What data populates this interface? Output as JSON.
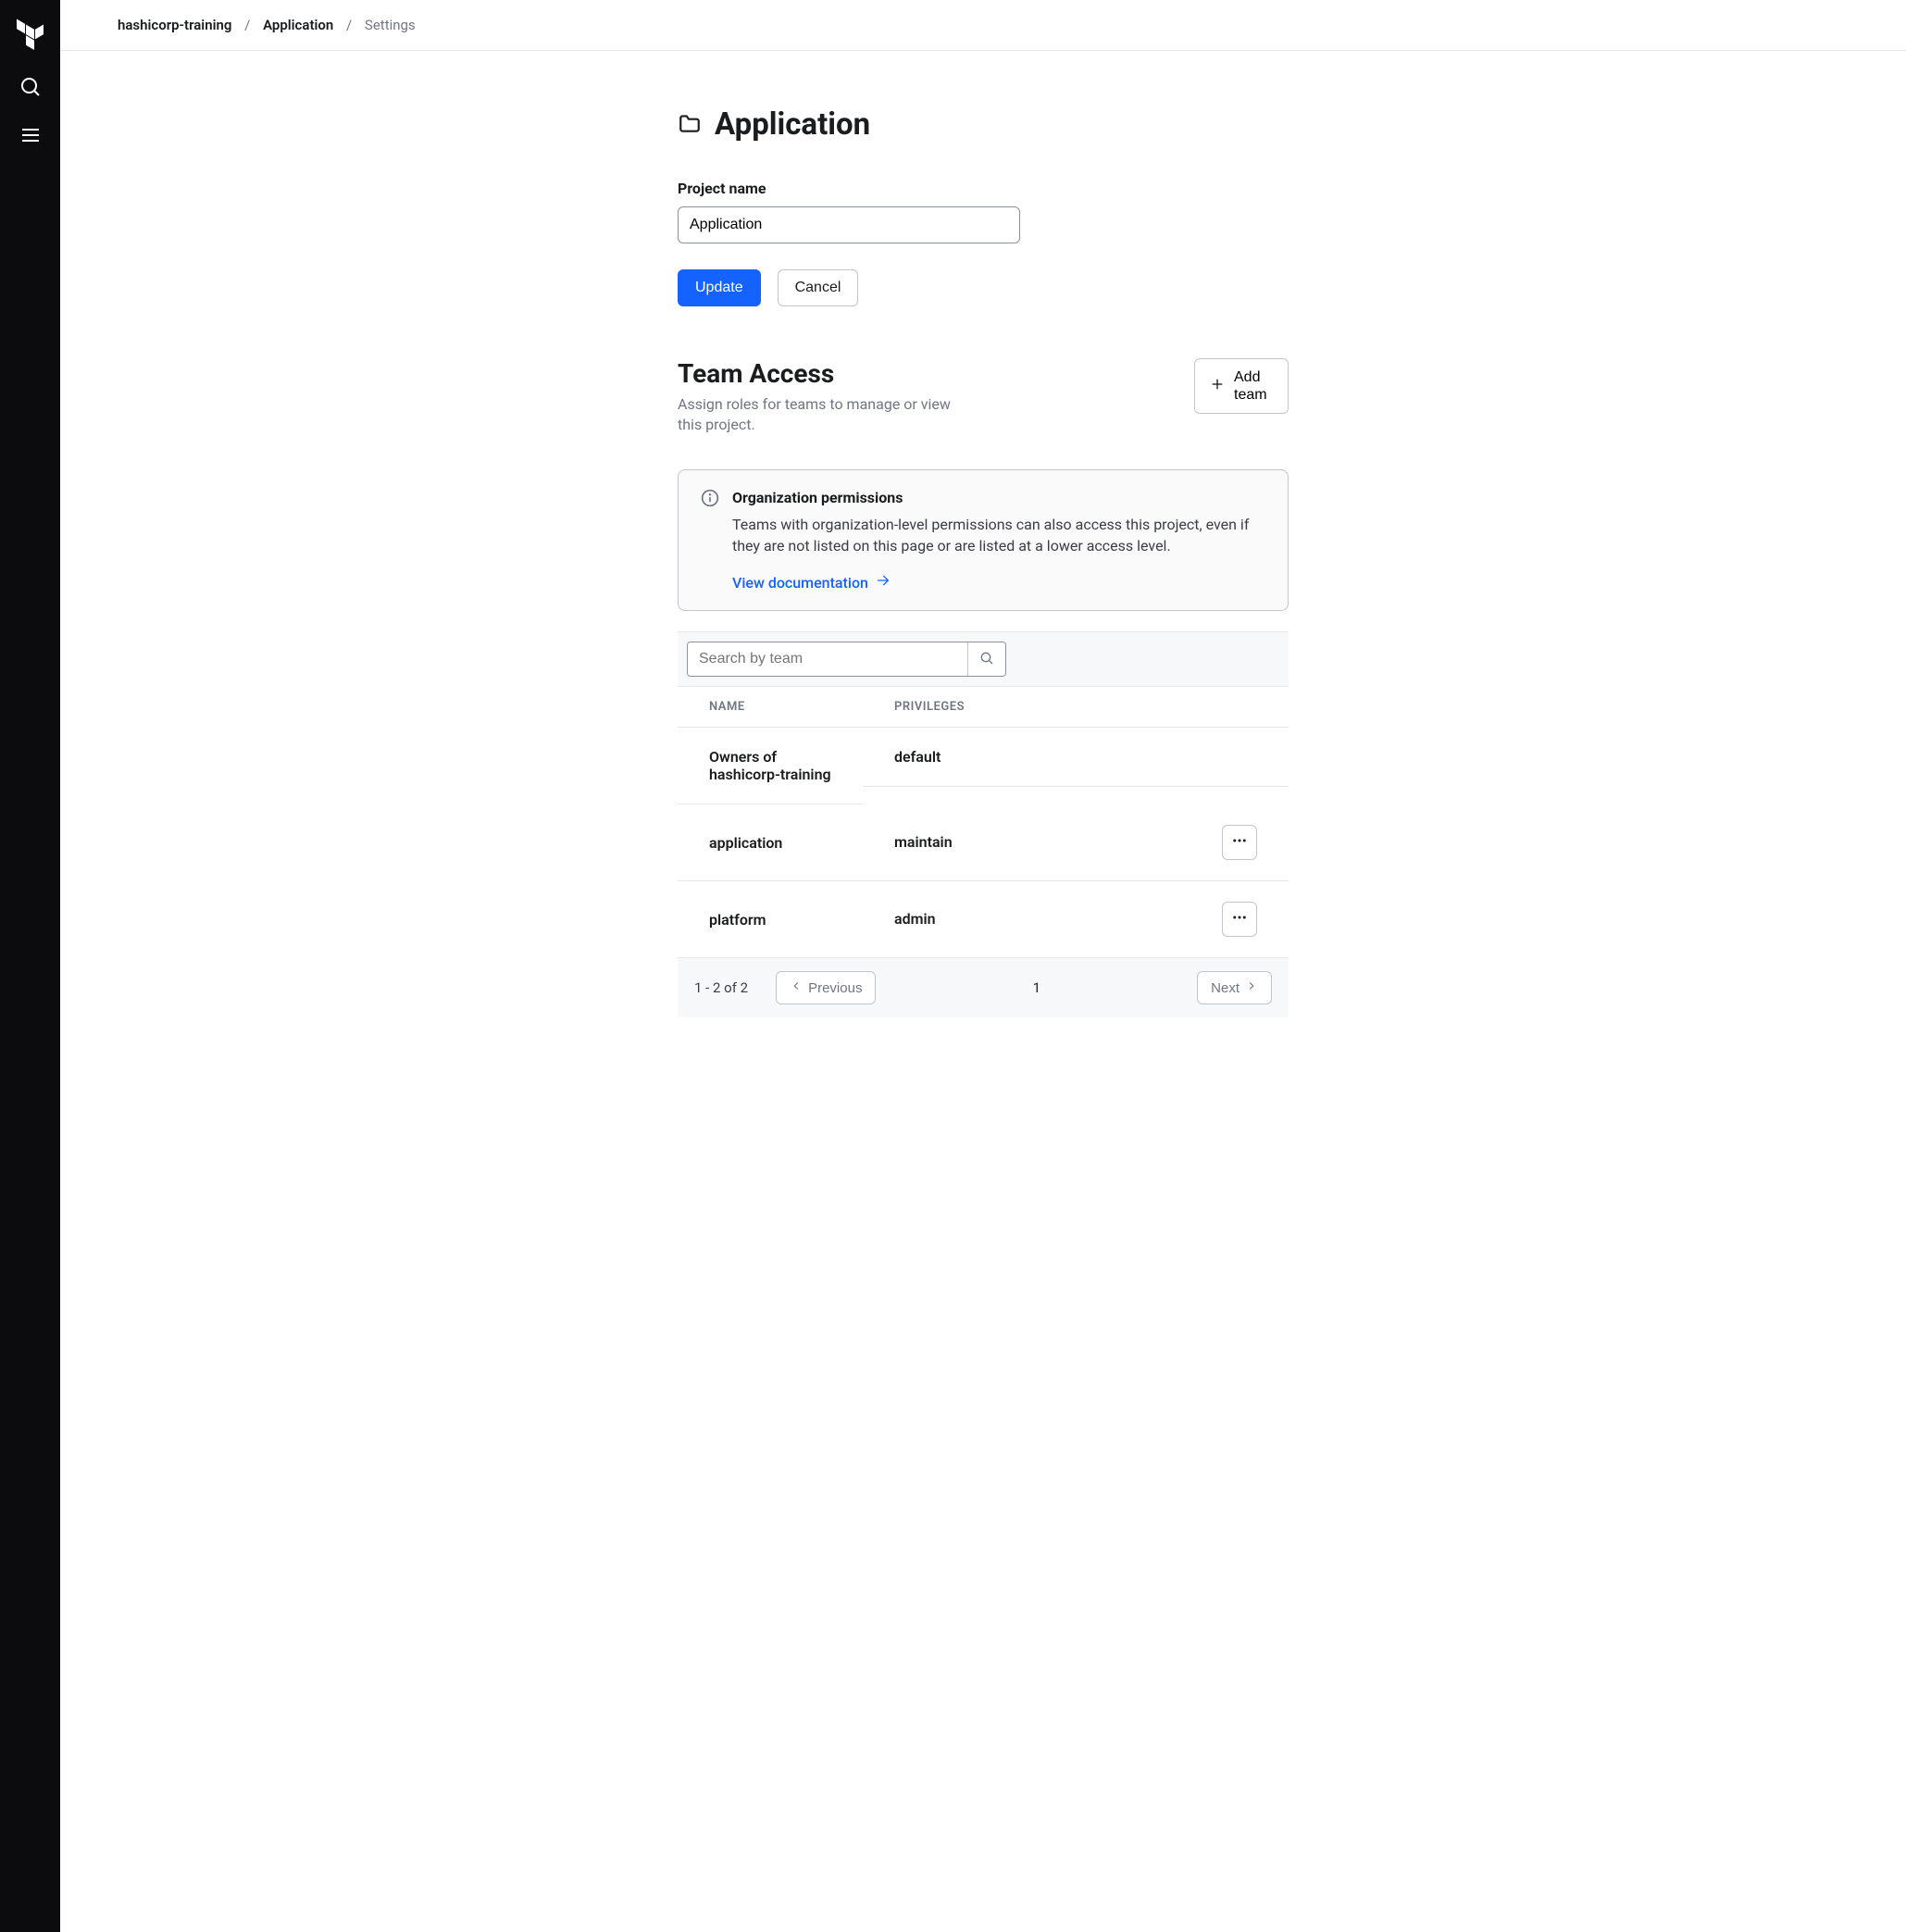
{
  "breadcrumb": {
    "org": "hashicorp-training",
    "project": "Application",
    "current": "Settings"
  },
  "page": {
    "title": "Application"
  },
  "form": {
    "name_label": "Project name",
    "name_value": "Application",
    "update_label": "Update",
    "cancel_label": "Cancel"
  },
  "team_access": {
    "heading": "Team Access",
    "subtext": "Assign roles for teams to manage or view this project.",
    "add_team_label": "Add team"
  },
  "info": {
    "title": "Organization permissions",
    "body": "Teams with organization-level permissions can also access this project, even if they are not listed on this page or are listed at a lower access level.",
    "link_label": "View documentation"
  },
  "search": {
    "placeholder": "Search by team"
  },
  "table": {
    "col_name": "NAME",
    "col_priv": "PRIVILEGES",
    "rows": [
      {
        "name": "Owners of hashicorp-training",
        "priv": "default",
        "menu": false
      },
      {
        "name": "application",
        "priv": "maintain",
        "menu": true
      },
      {
        "name": "platform",
        "priv": "admin",
        "menu": true
      }
    ]
  },
  "pagination": {
    "range": "1 - 2 of 2",
    "prev": "Previous",
    "next": "Next",
    "page": "1"
  }
}
